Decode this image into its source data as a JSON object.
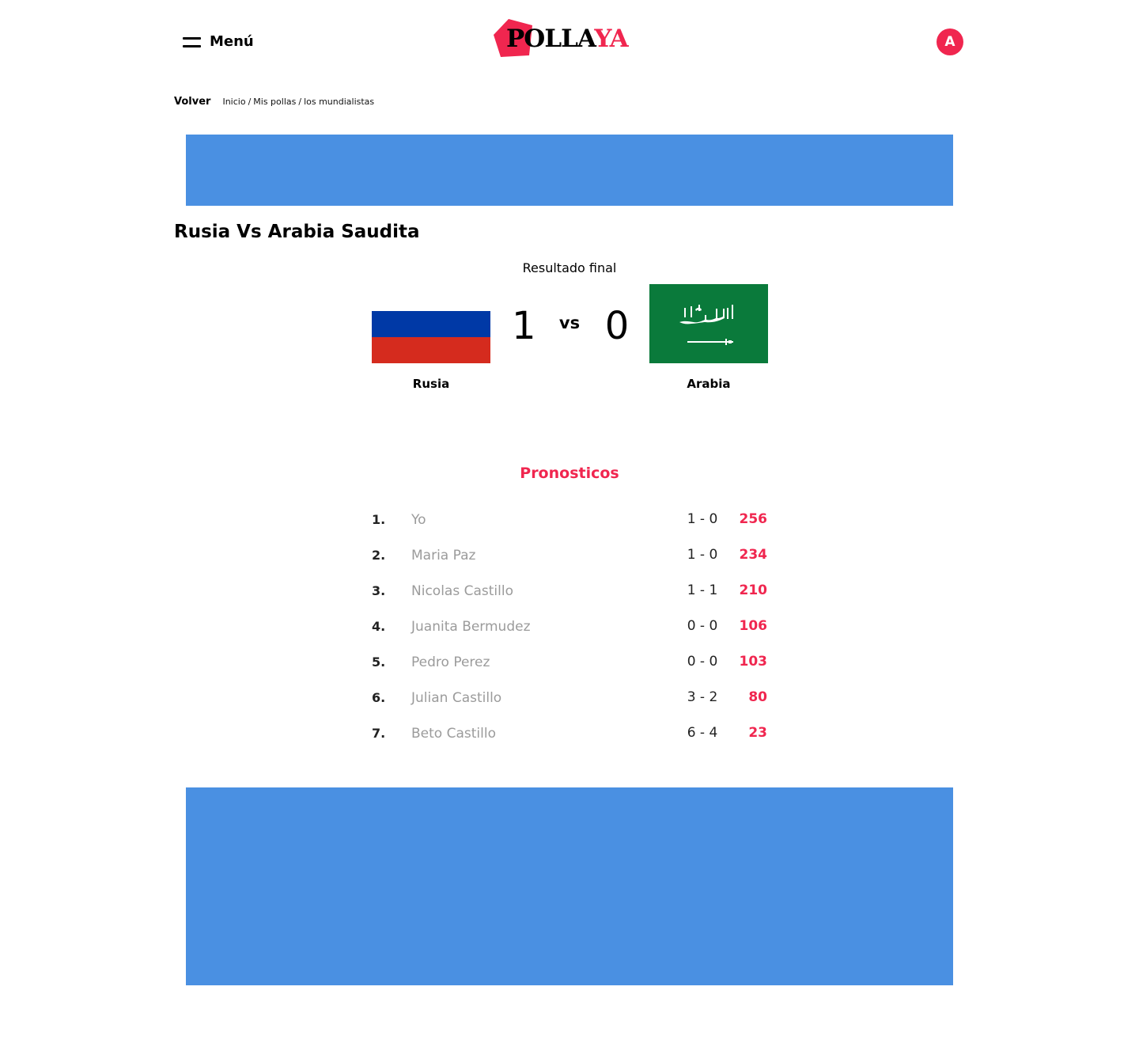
{
  "header": {
    "menu_label": "Menú",
    "logo_part1": "POLLA",
    "logo_part2": "YA",
    "avatar_initial": "A"
  },
  "colors": {
    "accent": "#f0264f",
    "banner": "#4a90e2"
  },
  "breadcrumb": {
    "back_label": "Volver",
    "items": [
      "Inicio",
      "Mis pollas",
      "los mundialistas"
    ]
  },
  "match": {
    "title": "Rusia Vs Arabia Saudita",
    "result_label": "Resultado final",
    "vs_label": "vs",
    "home": {
      "name": "Rusia",
      "score": "1",
      "flag_icon": "russia-flag-icon"
    },
    "away": {
      "name": "Arabia",
      "score": "0",
      "flag_icon": "saudi-arabia-flag-icon"
    }
  },
  "predictions": {
    "title": "Pronosticos",
    "rows": [
      {
        "rank": "1.",
        "name": "Yo",
        "score": "1 - 0",
        "points": "256"
      },
      {
        "rank": "2.",
        "name": "Maria Paz",
        "score": "1 - 0",
        "points": "234"
      },
      {
        "rank": "3.",
        "name": "Nicolas Castillo",
        "score": "1 - 1",
        "points": "210"
      },
      {
        "rank": "4.",
        "name": "Juanita Bermudez",
        "score": "0 - 0",
        "points": "106"
      },
      {
        "rank": "5.",
        "name": "Pedro Perez",
        "score": "0 - 0",
        "points": "103"
      },
      {
        "rank": "6.",
        "name": "Julian Castillo",
        "score": "3 - 2",
        "points": "80"
      },
      {
        "rank": "7.",
        "name": "Beto Castillo",
        "score": "6 - 4",
        "points": "23"
      }
    ]
  }
}
